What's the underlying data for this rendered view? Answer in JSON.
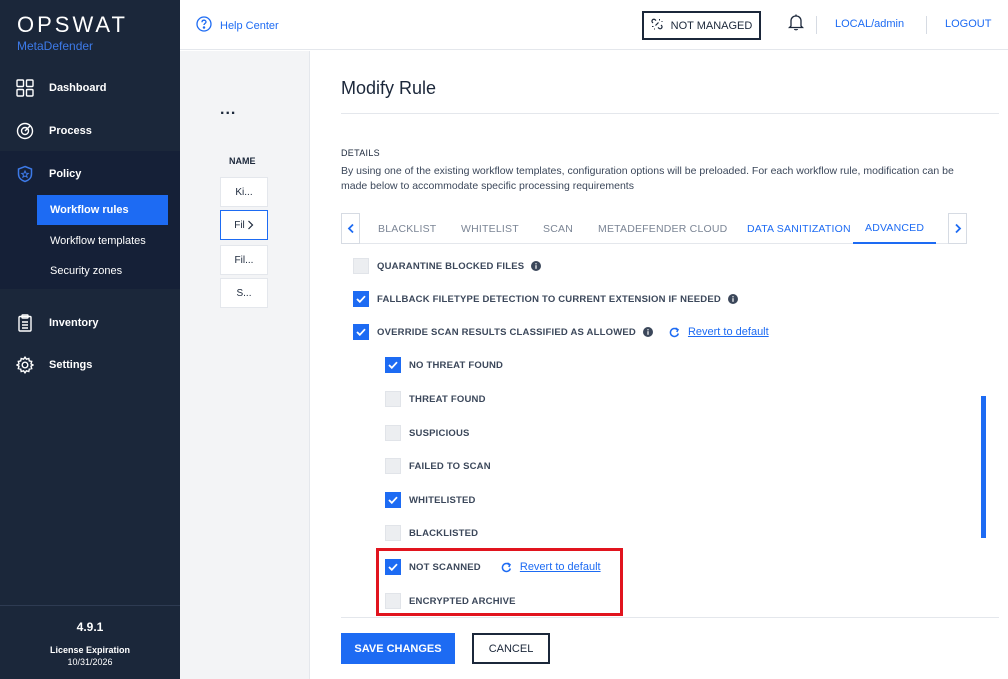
{
  "brand": {
    "logo": "OPSWAT",
    "product": "MetaDefender"
  },
  "sidebar": {
    "items": [
      {
        "label": "Dashboard",
        "icon": "dashboard-icon"
      },
      {
        "label": "Process",
        "icon": "process-icon"
      },
      {
        "label": "Policy",
        "icon": "shield-icon"
      },
      {
        "label": "Inventory",
        "icon": "clipboard-icon"
      },
      {
        "label": "Settings",
        "icon": "gear-icon"
      }
    ],
    "policy_sub": [
      "Workflow rules",
      "Workflow templates",
      "Security zones"
    ],
    "active_sub": "Workflow rules",
    "version": "4.9.1",
    "license_label": "License Expiration",
    "license_date": "10/31/2026"
  },
  "topbar": {
    "help": "Help Center",
    "managed": "NOT MANAGED",
    "user": "LOCAL/admin",
    "logout": "LOGOUT"
  },
  "list": {
    "menu": "...",
    "header": "NAME",
    "rows": [
      "Ki...",
      "Fil",
      "Fil...",
      "S..."
    ]
  },
  "main": {
    "title": "Modify Rule",
    "details_heading": "DETAILS",
    "details_text": "By using one of the existing workflow templates, configuration options will be preloaded. For each workflow rule, modification can be made below to accommodate specific processing requirements",
    "tabs": [
      "BLACKLIST",
      "WHITELIST",
      "SCAN",
      "METADEFENDER CLOUD",
      "DATA SANITIZATION",
      "ADVANCED"
    ],
    "active_tab": "ADVANCED",
    "options": {
      "quarantine": {
        "label": "QUARANTINE BLOCKED FILES",
        "checked": false
      },
      "fallback": {
        "label": "FALLBACK FILETYPE DETECTION TO CURRENT EXTENSION IF NEEDED",
        "checked": true
      },
      "override": {
        "label": "OVERRIDE SCAN RESULTS CLASSIFIED AS ALLOWED",
        "checked": true
      }
    },
    "revert": "Revert to default",
    "results": [
      {
        "label": "NO THREAT FOUND",
        "checked": true
      },
      {
        "label": "THREAT FOUND",
        "checked": false
      },
      {
        "label": "SUSPICIOUS",
        "checked": false
      },
      {
        "label": "FAILED TO SCAN",
        "checked": false
      },
      {
        "label": "WHITELISTED",
        "checked": true
      },
      {
        "label": "BLACKLISTED",
        "checked": false
      },
      {
        "label": "NOT SCANNED",
        "checked": true
      },
      {
        "label": "ENCRYPTED ARCHIVE",
        "checked": false
      }
    ],
    "save": "SAVE CHANGES",
    "cancel": "CANCEL"
  },
  "colors": {
    "sidebar": "#1b273a",
    "accent": "#1d6bf3",
    "highlight": "#e1141e"
  }
}
